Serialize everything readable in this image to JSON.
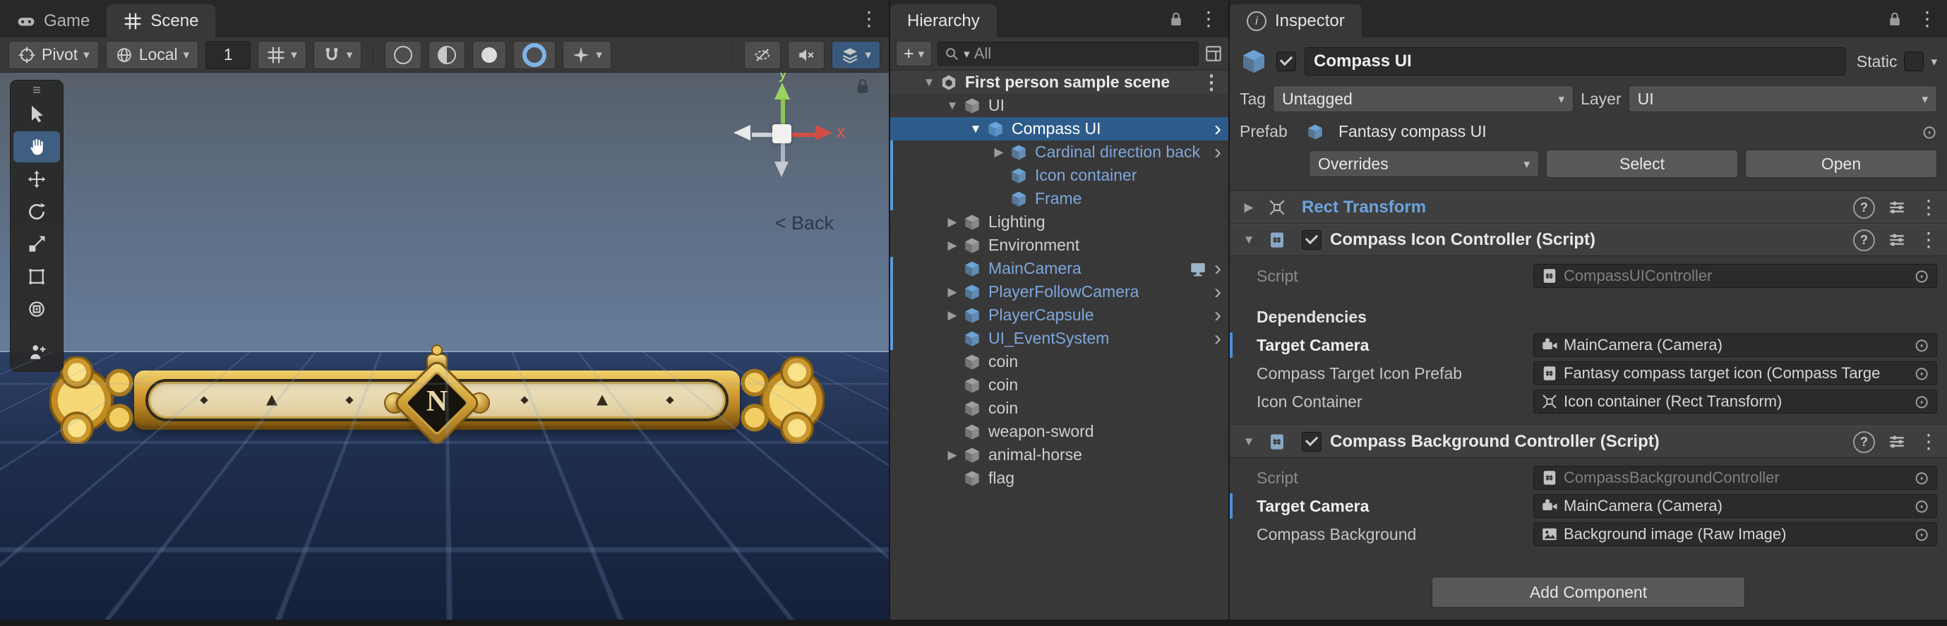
{
  "scene_panel": {
    "tabs": {
      "game": "Game",
      "scene": "Scene"
    },
    "toolbar": {
      "pivot_label": "Pivot",
      "handle_rotation_label": "Local",
      "grid_size_value": "1"
    },
    "viewport": {
      "orientation_label": "< Back",
      "gizmo_axis_x": "x",
      "gizmo_axis_y": "y",
      "compass_north": "N"
    }
  },
  "hierarchy": {
    "tab_label": "Hierarchy",
    "create_button_label": "+",
    "search_value": "All",
    "rows": [
      {
        "label": "First person sample scene",
        "type": "scene",
        "level": 0,
        "expanded": true
      },
      {
        "label": "UI",
        "type": "gameobject",
        "level": 1,
        "expanded": true
      },
      {
        "label": "Compass UI",
        "type": "prefab",
        "level": 2,
        "expanded": true,
        "selected": true
      },
      {
        "label": "Cardinal direction back",
        "type": "prefab",
        "level": 3,
        "collapsed": true
      },
      {
        "label": "Icon container",
        "type": "prefab",
        "level": 3
      },
      {
        "label": "Frame",
        "type": "prefab",
        "level": 3
      },
      {
        "label": "Lighting",
        "type": "gameobject",
        "level": 1,
        "collapsed": true
      },
      {
        "label": "Environment",
        "type": "gameobject",
        "level": 1,
        "collapsed": true
      },
      {
        "label": "MainCamera",
        "type": "prefab",
        "level": 1
      },
      {
        "label": "PlayerFollowCamera",
        "type": "prefab",
        "level": 1,
        "collapsed": true
      },
      {
        "label": "PlayerCapsule",
        "type": "prefab",
        "level": 1,
        "collapsed": true
      },
      {
        "label": "UI_EventSystem",
        "type": "prefab",
        "level": 1
      },
      {
        "label": "coin",
        "type": "gameobject",
        "level": 1
      },
      {
        "label": "coin",
        "type": "gameobject",
        "level": 1
      },
      {
        "label": "coin",
        "type": "gameobject",
        "level": 1
      },
      {
        "label": "weapon-sword",
        "type": "gameobject",
        "level": 1
      },
      {
        "label": "animal-horse",
        "type": "gameobject",
        "level": 1,
        "collapsed": true
      },
      {
        "label": "flag",
        "type": "gameobject",
        "level": 1
      }
    ]
  },
  "inspector": {
    "tab_label": "Inspector",
    "header": {
      "name": "Compass UI",
      "static_label": "Static",
      "tag_label": "Tag",
      "tag_value": "Untagged",
      "layer_label": "Layer",
      "layer_value": "UI",
      "prefab_label": "Prefab",
      "prefab_value": "Fantasy compass UI",
      "overrides_label": "Overrides",
      "select_label": "Select",
      "open_label": "Open"
    },
    "rect_transform": {
      "title": "Rect Transform"
    },
    "icon_controller": {
      "title": "Compass Icon Controller (Script)",
      "script_label": "Script",
      "script_value": "CompassUIController",
      "dependencies_label": "Dependencies",
      "target_camera_label": "Target Camera",
      "target_camera_value": "MainCamera (Camera)",
      "target_icon_prefab_label": "Compass Target Icon Prefab",
      "target_icon_prefab_value": "Fantasy compass target icon (Compass Targe",
      "icon_container_label": "Icon Container",
      "icon_container_value": "Icon container (Rect Transform)"
    },
    "background_controller": {
      "title": "Compass Background Controller (Script)",
      "script_label": "Script",
      "script_value": "CompassBackgroundController",
      "target_camera_label": "Target Camera",
      "target_camera_value": "MainCamera (Camera)",
      "compass_background_label": "Compass Background",
      "compass_background_value": "Background image (Raw Image)"
    },
    "add_component_label": "Add Component"
  },
  "colors": {
    "selection_blue": "#2d5c8a",
    "prefab_text_blue": "#7fa6dc",
    "override_bar_blue": "#4a90d9",
    "compass_gold": "#d9a63e"
  }
}
